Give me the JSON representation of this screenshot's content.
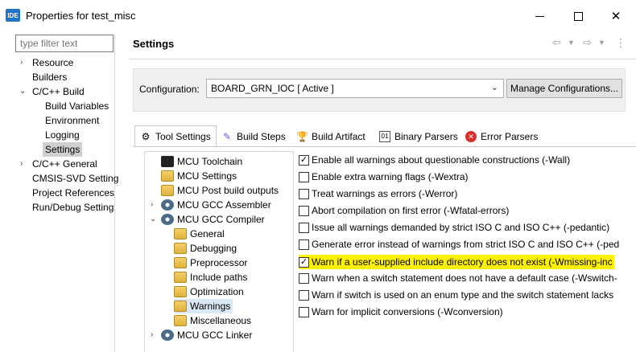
{
  "window": {
    "app_icon_text": "IDE",
    "title": "Properties for test_misc"
  },
  "nav": {
    "filter_placeholder": "type filter text",
    "items": [
      {
        "label": "Resource"
      },
      {
        "label": "Builders"
      },
      {
        "label": "C/C++ Build"
      },
      {
        "label": "Build Variables"
      },
      {
        "label": "Environment"
      },
      {
        "label": "Logging"
      },
      {
        "label": "Settings"
      },
      {
        "label": "C/C++ General"
      },
      {
        "label": "CMSIS-SVD Setting"
      },
      {
        "label": "Project References"
      },
      {
        "label": "Run/Debug Setting"
      }
    ]
  },
  "header": {
    "title": "Settings"
  },
  "config": {
    "label": "Configuration:",
    "value": "BOARD_GRN_IOC  [ Active ]",
    "manage_button": "Manage Configurations..."
  },
  "tabs": [
    {
      "label": "Tool Settings",
      "icon": "tool-settings-icon"
    },
    {
      "label": "Build Steps",
      "icon": "build-steps-icon"
    },
    {
      "label": "Build Artifact",
      "icon": "build-artifact-icon"
    },
    {
      "label": "Binary Parsers",
      "icon": "binary-parsers-icon"
    },
    {
      "label": "Error Parsers",
      "icon": "error-parsers-icon"
    }
  ],
  "tool_tree": [
    {
      "label": "MCU Toolchain"
    },
    {
      "label": "MCU Settings"
    },
    {
      "label": "MCU Post build outputs"
    },
    {
      "label": "MCU GCC Assembler"
    },
    {
      "label": "MCU GCC Compiler"
    },
    {
      "label": "General"
    },
    {
      "label": "Debugging"
    },
    {
      "label": "Preprocessor"
    },
    {
      "label": "Include paths"
    },
    {
      "label": "Optimization"
    },
    {
      "label": "Warnings"
    },
    {
      "label": "Miscellaneous"
    },
    {
      "label": "MCU GCC Linker"
    }
  ],
  "warnings": [
    {
      "label": "Enable all warnings about questionable constructions (-Wall)",
      "checked": true
    },
    {
      "label": "Enable extra warning flags (-Wextra)",
      "checked": false
    },
    {
      "label": "Treat warnings as errors (-Werror)",
      "checked": false
    },
    {
      "label": "Abort compilation on first error (-Wfatal-errors)",
      "checked": false
    },
    {
      "label": "Issue all warnings demanded by strict ISO C and ISO C++ (-pedantic)",
      "checked": false
    },
    {
      "label": "Generate error instead of warnings from strict ISO C and ISO C++ (-ped",
      "checked": false
    },
    {
      "label": "Warn if a user-supplied include directory does not exist (-Wmissing-inc",
      "checked": true
    },
    {
      "label": "Warn when a switch statement does not have a default case (-Wswitch-",
      "checked": false
    },
    {
      "label": "Warn if switch is used on an enum type and the switch statement lacks",
      "checked": false
    },
    {
      "label": "Warn for implicit conversions (-Wconversion)",
      "checked": false
    }
  ],
  "colors": {
    "highlight": "#fff200",
    "selection": "#dbe8f6",
    "accent": "#1e74c6"
  }
}
